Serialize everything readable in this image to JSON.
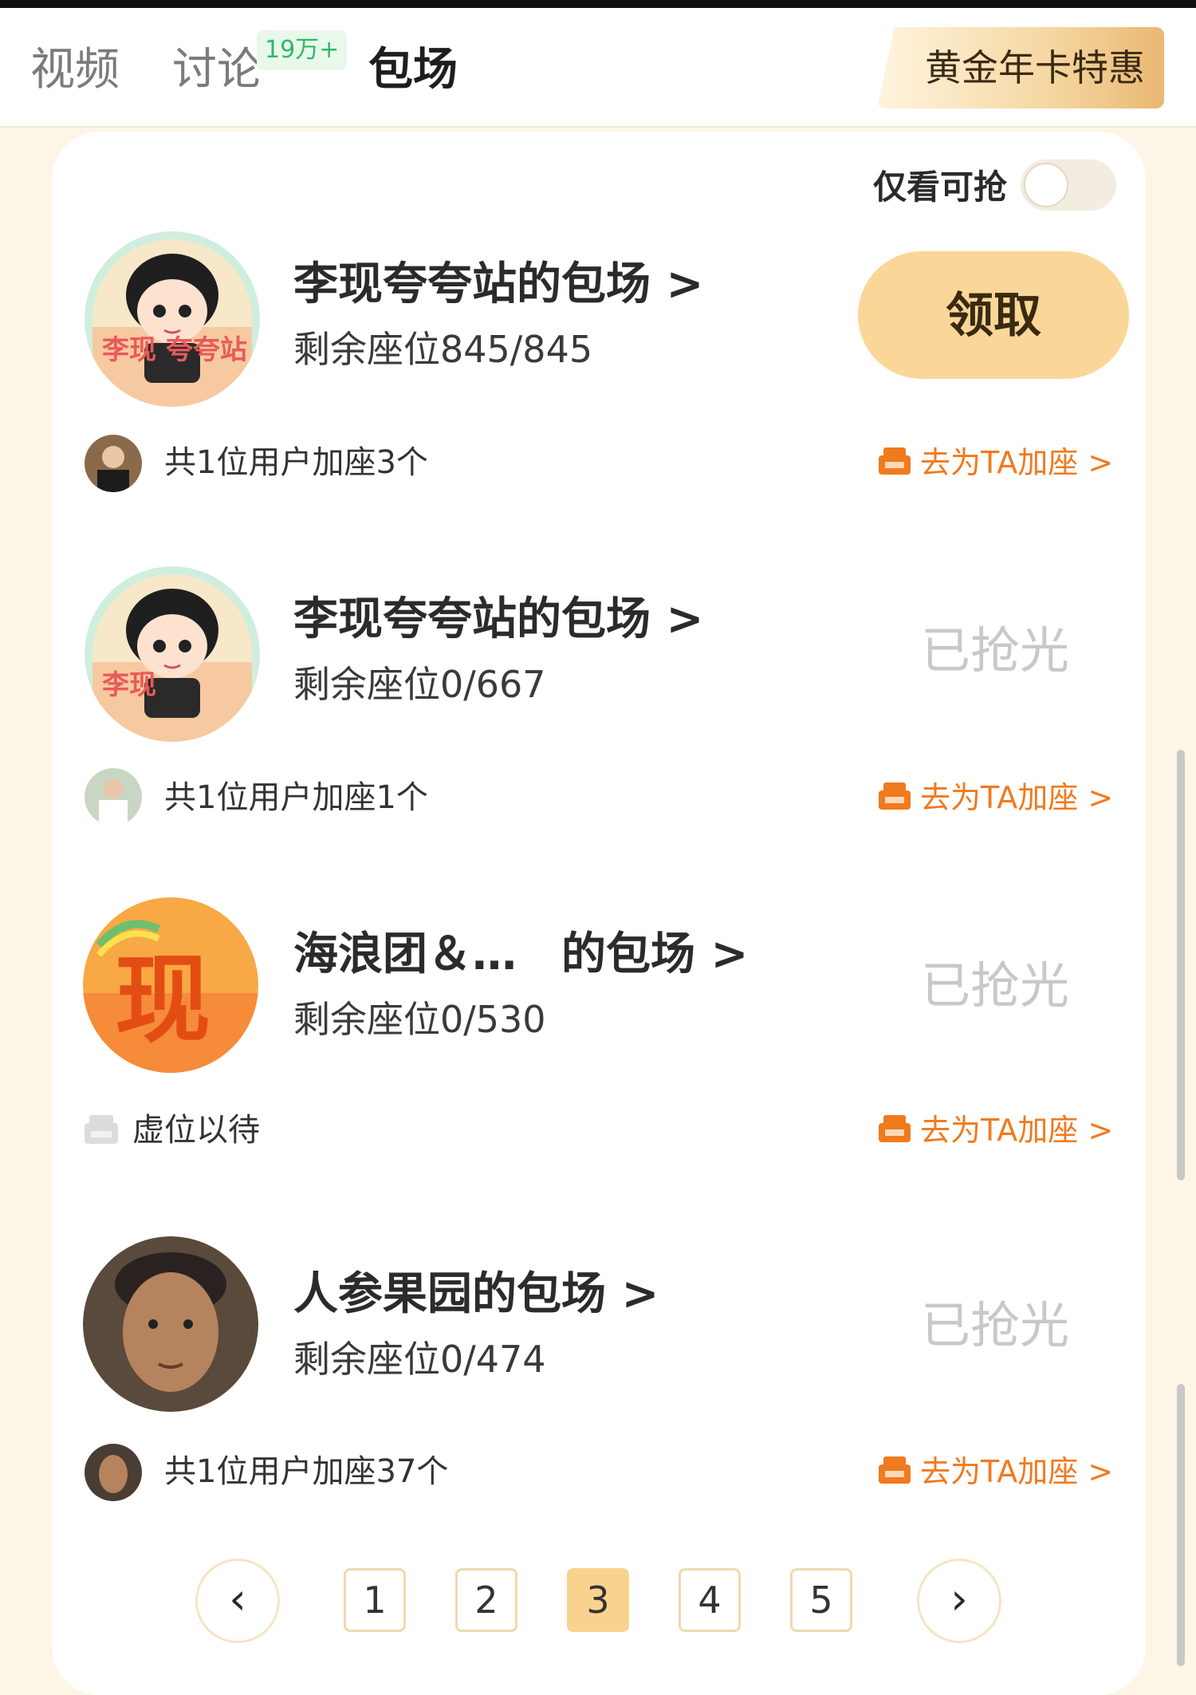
{
  "header": {
    "tabs": [
      {
        "label": "视频"
      },
      {
        "label": "讨论",
        "badge": "19万+"
      },
      {
        "label": "包场"
      }
    ],
    "active_tab": "包场",
    "promo_label": "黄金年卡特惠"
  },
  "filter": {
    "label": "仅看可抢",
    "enabled": false
  },
  "sessions": [
    {
      "title": "李现夸夸站的包场 >",
      "seats": "剩余座位845/845",
      "action": "领取",
      "joined": "共1位用户加座3个",
      "link": "去为TA加座 >"
    },
    {
      "title": "李现夸夸站的包场 >",
      "seats": "剩余座位0/667",
      "status": "已抢光",
      "joined": "共1位用户加座1个",
      "link": "去为TA加座 >"
    },
    {
      "title": "海浪团＆…　的包场 >",
      "seats": "剩余座位0/530",
      "status": "已抢光",
      "joined": "虚位以待",
      "link": "去为TA加座 >"
    },
    {
      "title": "人参果园的包场 >",
      "seats": "剩余座位0/474",
      "status": "已抢光",
      "joined": "共1位用户加座37个",
      "link": "去为TA加座 >"
    }
  ],
  "pagination": {
    "pages": [
      "1",
      "2",
      "3",
      "4",
      "5"
    ],
    "current": "3",
    "prev_icon": "‹",
    "next_icon": "›"
  },
  "colors": {
    "accent_orange": "#f07a1e",
    "claim_button": "#fad798",
    "badge_green": "#2fb86a"
  },
  "avatars": {
    "avatar_1_text": "李现 夸夸站",
    "avatar_3_text": "现"
  }
}
